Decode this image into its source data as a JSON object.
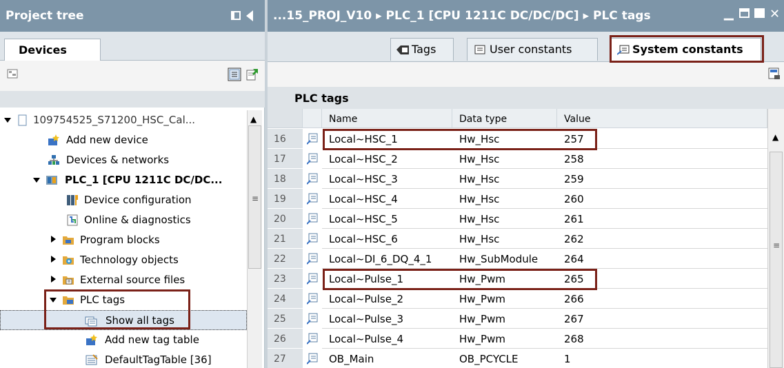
{
  "project_tree": {
    "title": "Project tree",
    "devices_tab": "Devices",
    "items": [
      {
        "label": "109754525_S71200_HSC_Cal..."
      },
      {
        "label": "Add new device"
      },
      {
        "label": "Devices & networks"
      },
      {
        "label": "PLC_1 [CPU 1211C DC/DC..."
      },
      {
        "label": "Device configuration"
      },
      {
        "label": "Online & diagnostics"
      },
      {
        "label": "Program blocks"
      },
      {
        "label": "Technology objects"
      },
      {
        "label": "External source files"
      },
      {
        "label": "PLC tags"
      },
      {
        "label": "Show all tags"
      },
      {
        "label": "Add new tag table"
      },
      {
        "label": "DefaultTagTable [36]"
      }
    ]
  },
  "editor": {
    "breadcrumb": "...15_PROJ_V10 ▸ PLC_1 [CPU 1211C DC/DC/DC] ▸ PLC tags",
    "tabs": [
      {
        "label": "Tags"
      },
      {
        "label": "User constants"
      },
      {
        "label": "System constants"
      }
    ],
    "table_title": "PLC tags",
    "columns": {
      "name": "Name",
      "type": "Data type",
      "value": "Value"
    },
    "rows": [
      {
        "num": "16",
        "name": "Local~HSC_1",
        "type": "Hw_Hsc",
        "value": "257"
      },
      {
        "num": "17",
        "name": "Local~HSC_2",
        "type": "Hw_Hsc",
        "value": "258"
      },
      {
        "num": "18",
        "name": "Local~HSC_3",
        "type": "Hw_Hsc",
        "value": "259"
      },
      {
        "num": "19",
        "name": "Local~HSC_4",
        "type": "Hw_Hsc",
        "value": "260"
      },
      {
        "num": "20",
        "name": "Local~HSC_5",
        "type": "Hw_Hsc",
        "value": "261"
      },
      {
        "num": "21",
        "name": "Local~HSC_6",
        "type": "Hw_Hsc",
        "value": "262"
      },
      {
        "num": "22",
        "name": "Local~DI_6_DQ_4_1",
        "type": "Hw_SubModule",
        "value": "264"
      },
      {
        "num": "23",
        "name": "Local~Pulse_1",
        "type": "Hw_Pwm",
        "value": "265"
      },
      {
        "num": "24",
        "name": "Local~Pulse_2",
        "type": "Hw_Pwm",
        "value": "266"
      },
      {
        "num": "25",
        "name": "Local~Pulse_3",
        "type": "Hw_Pwm",
        "value": "267"
      },
      {
        "num": "26",
        "name": "Local~Pulse_4",
        "type": "Hw_Pwm",
        "value": "268"
      },
      {
        "num": "27",
        "name": "OB_Main",
        "type": "OB_PCYCLE",
        "value": "1"
      }
    ]
  },
  "colors": {
    "header": "#7d95a8",
    "highlight": "#7a2118",
    "tabstrip": "#dfe5ea"
  }
}
